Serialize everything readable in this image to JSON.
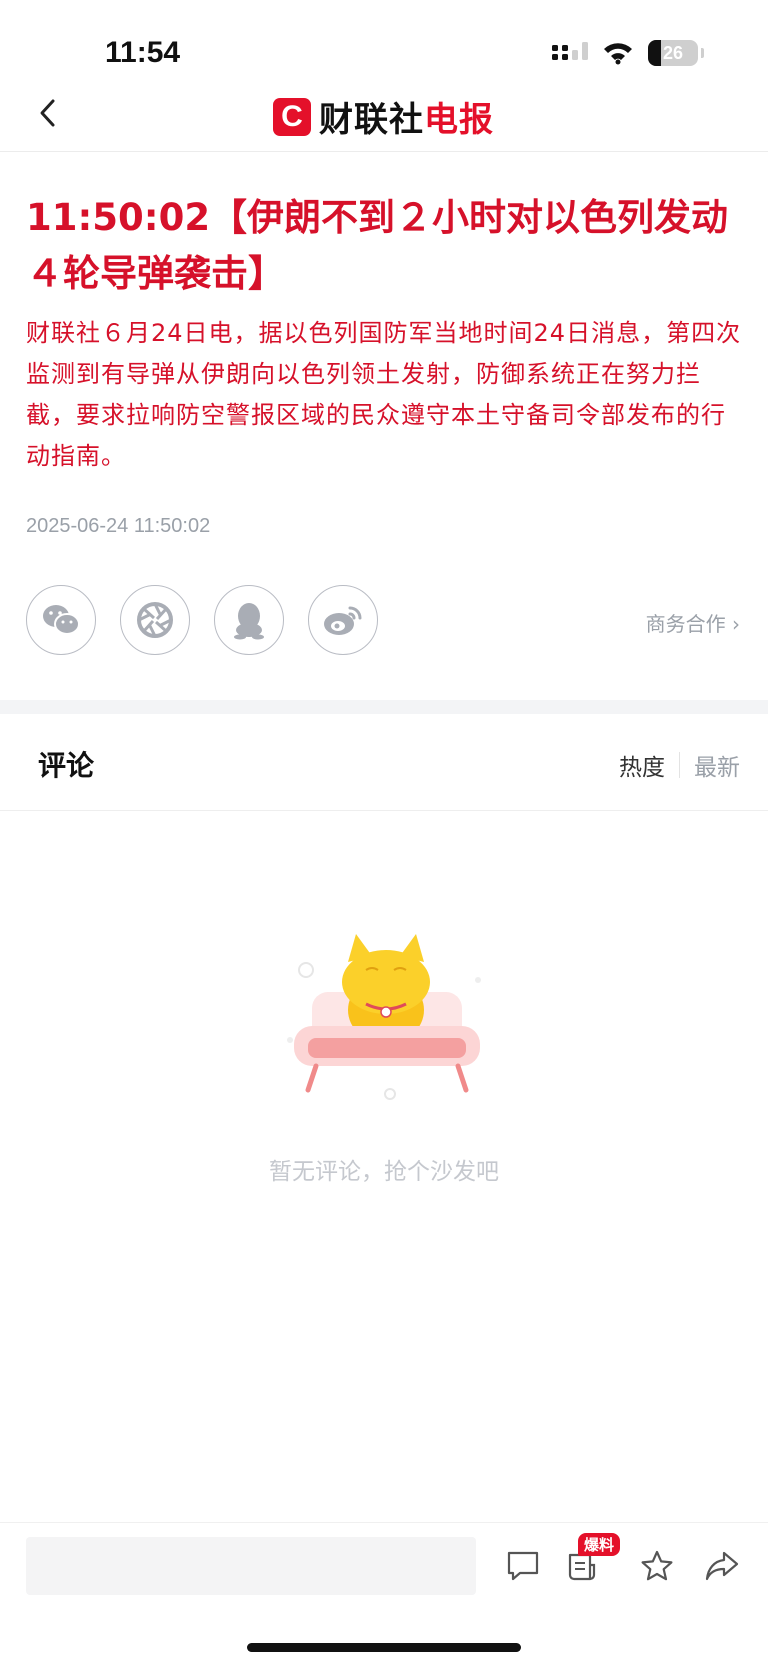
{
  "status_bar": {
    "time": "11:54",
    "battery": "26"
  },
  "header": {
    "logo_letter": "C",
    "logo_black": "财联社",
    "logo_red": "电报",
    "back_icon": "chevron-left-icon"
  },
  "article": {
    "headline": "11:50:02【伊朗不到２小时对以色列发动４轮导弹袭击】",
    "body": "财联社６月24日电，据以色列国防军当地时间24日消息，第四次监测到有导弹从伊朗向以色列领土发射，防御系统正在努力拦截，要求拉响防空警报区域的民众遵守本土守备司令部发布的行动指南。",
    "timestamp": "2025-06-24 11:50:02"
  },
  "share": {
    "items": [
      {
        "name": "wechat-icon"
      },
      {
        "name": "moments-icon"
      },
      {
        "name": "qq-icon"
      },
      {
        "name": "weibo-icon"
      }
    ],
    "business_link": "商务合作 ›"
  },
  "comments": {
    "title": "评论",
    "sort_hot": "热度",
    "sort_new": "最新",
    "empty_text": "暂无评论，抢个沙发吧"
  },
  "bottom_bar": {
    "input_placeholder": "",
    "badge": "爆料"
  },
  "colors": {
    "brand_red": "#e4102a",
    "headline_red": "#d6112a",
    "muted_gray": "#9aa0a8"
  }
}
